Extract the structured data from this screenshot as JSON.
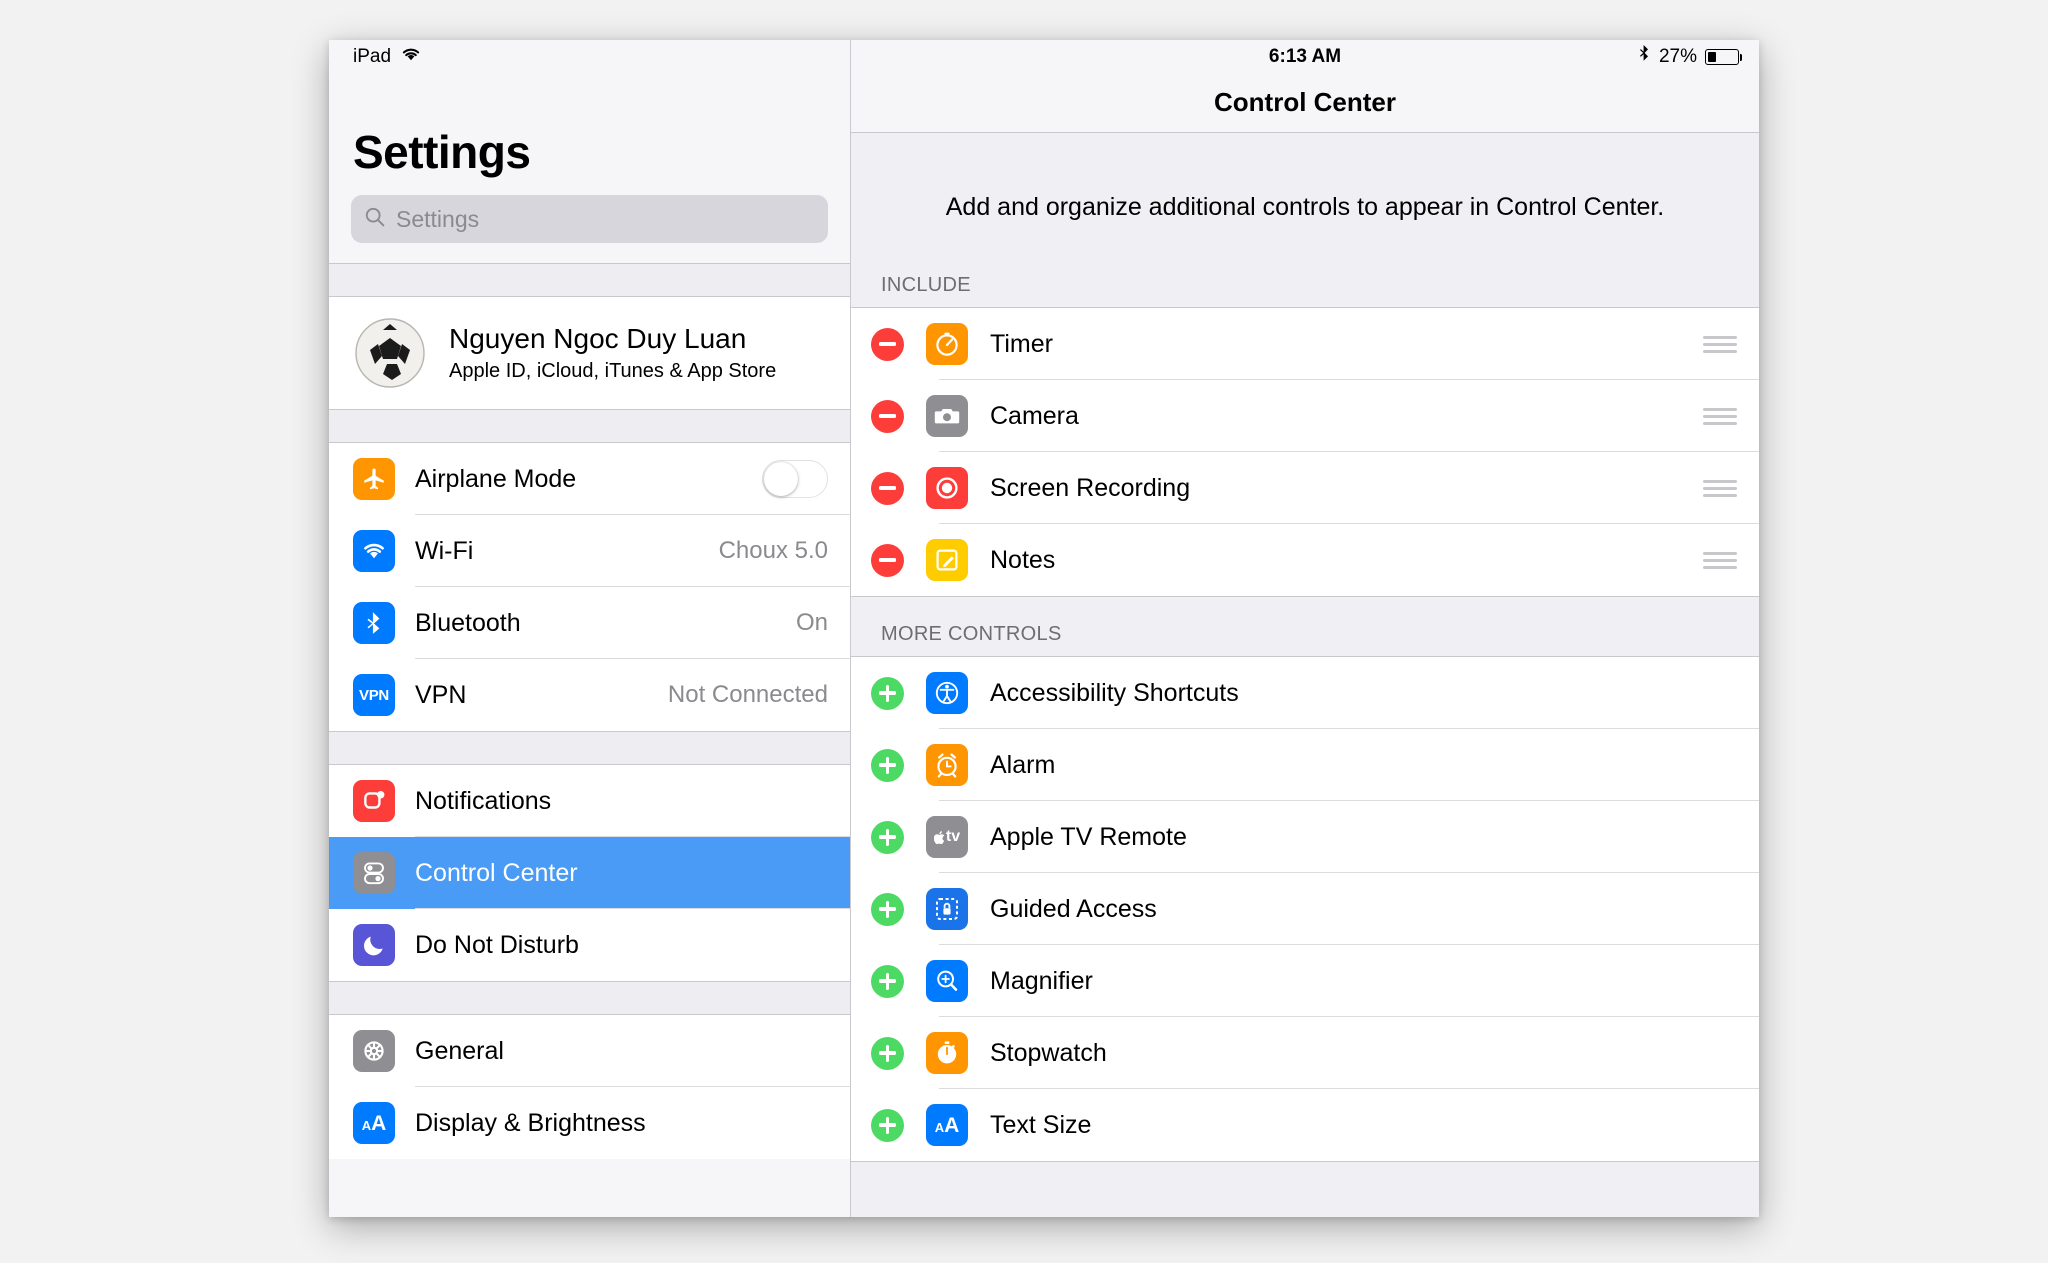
{
  "status_bar": {
    "device_label": "iPad",
    "wifi_icon": "wifi-icon",
    "time": "6:13 AM",
    "bluetooth_icon": "bluetooth-icon",
    "battery_percent_label": "27%",
    "battery_level": 27
  },
  "sidebar": {
    "title": "Settings",
    "search": {
      "placeholder": "Settings",
      "value": "",
      "icon": "search-icon"
    },
    "account": {
      "name": "Nguyen Ngoc Duy Luan",
      "subtitle": "Apple ID, iCloud, iTunes & App Store",
      "avatar": "soccer-ball-avatar"
    },
    "groups": [
      {
        "items": [
          {
            "label": "Airplane Mode",
            "icon": "airplane-icon",
            "icon_color": "#ff9500",
            "control": "toggle",
            "toggle_on": false,
            "value": ""
          },
          {
            "label": "Wi-Fi",
            "icon": "wifi-icon",
            "icon_color": "#007aff",
            "value": "Choux 5.0"
          },
          {
            "label": "Bluetooth",
            "icon": "bluetooth-icon",
            "icon_color": "#007aff",
            "value": "On"
          },
          {
            "label": "VPN",
            "icon": "vpn-icon",
            "icon_color": "#007aff",
            "value": "Not Connected"
          }
        ]
      },
      {
        "items": [
          {
            "label": "Notifications",
            "icon": "notifications-icon",
            "icon_color": "#fc3d39",
            "value": "",
            "selected": false
          },
          {
            "label": "Control Center",
            "icon": "control-center-icon",
            "icon_color": "#8e8e93",
            "value": "",
            "selected": true
          },
          {
            "label": "Do Not Disturb",
            "icon": "moon-icon",
            "icon_color": "#5856d6",
            "value": "",
            "selected": false
          }
        ]
      },
      {
        "items": [
          {
            "label": "General",
            "icon": "gear-icon",
            "icon_color": "#8e8e93",
            "value": ""
          },
          {
            "label": "Display & Brightness",
            "icon": "text-size-icon",
            "icon_color": "#007aff",
            "value": ""
          }
        ]
      }
    ]
  },
  "detail": {
    "title": "Control Center",
    "description": "Add and organize additional controls to appear in Control Center.",
    "sections": [
      {
        "header": "INCLUDE",
        "action": "remove",
        "rows": [
          {
            "label": "Timer",
            "icon": "timer-icon",
            "icon_color": "#ff9500",
            "handle": "drag-handle"
          },
          {
            "label": "Camera",
            "icon": "camera-icon",
            "icon_color": "#8e8e93",
            "handle": "drag-handle"
          },
          {
            "label": "Screen Recording",
            "icon": "screen-recording-icon",
            "icon_color": "#fc3d39",
            "handle": "drag-handle"
          },
          {
            "label": "Notes",
            "icon": "notes-icon",
            "icon_color": "#ffcc00",
            "handle": "drag-handle"
          }
        ]
      },
      {
        "header": "MORE CONTROLS",
        "action": "add",
        "rows": [
          {
            "label": "Accessibility Shortcuts",
            "icon": "accessibility-icon",
            "icon_color": "#007aff"
          },
          {
            "label": "Alarm",
            "icon": "alarm-icon",
            "icon_color": "#ff9500"
          },
          {
            "label": "Apple TV Remote",
            "icon": "apple-tv-remote-icon",
            "icon_color": "#8e8e93"
          },
          {
            "label": "Guided Access",
            "icon": "guided-access-icon",
            "icon_color": "#1a73e8"
          },
          {
            "label": "Magnifier",
            "icon": "magnifier-icon",
            "icon_color": "#007aff"
          },
          {
            "label": "Stopwatch",
            "icon": "stopwatch-icon",
            "icon_color": "#ff9500"
          },
          {
            "label": "Text Size",
            "icon": "text-size-icon",
            "icon_color": "#007aff"
          }
        ]
      }
    ]
  },
  "colors": {
    "accent_blue": "#4a9bf5",
    "remove_red": "#fc3d39",
    "add_green": "#4cd964",
    "panel_bg": "#efeff4"
  }
}
